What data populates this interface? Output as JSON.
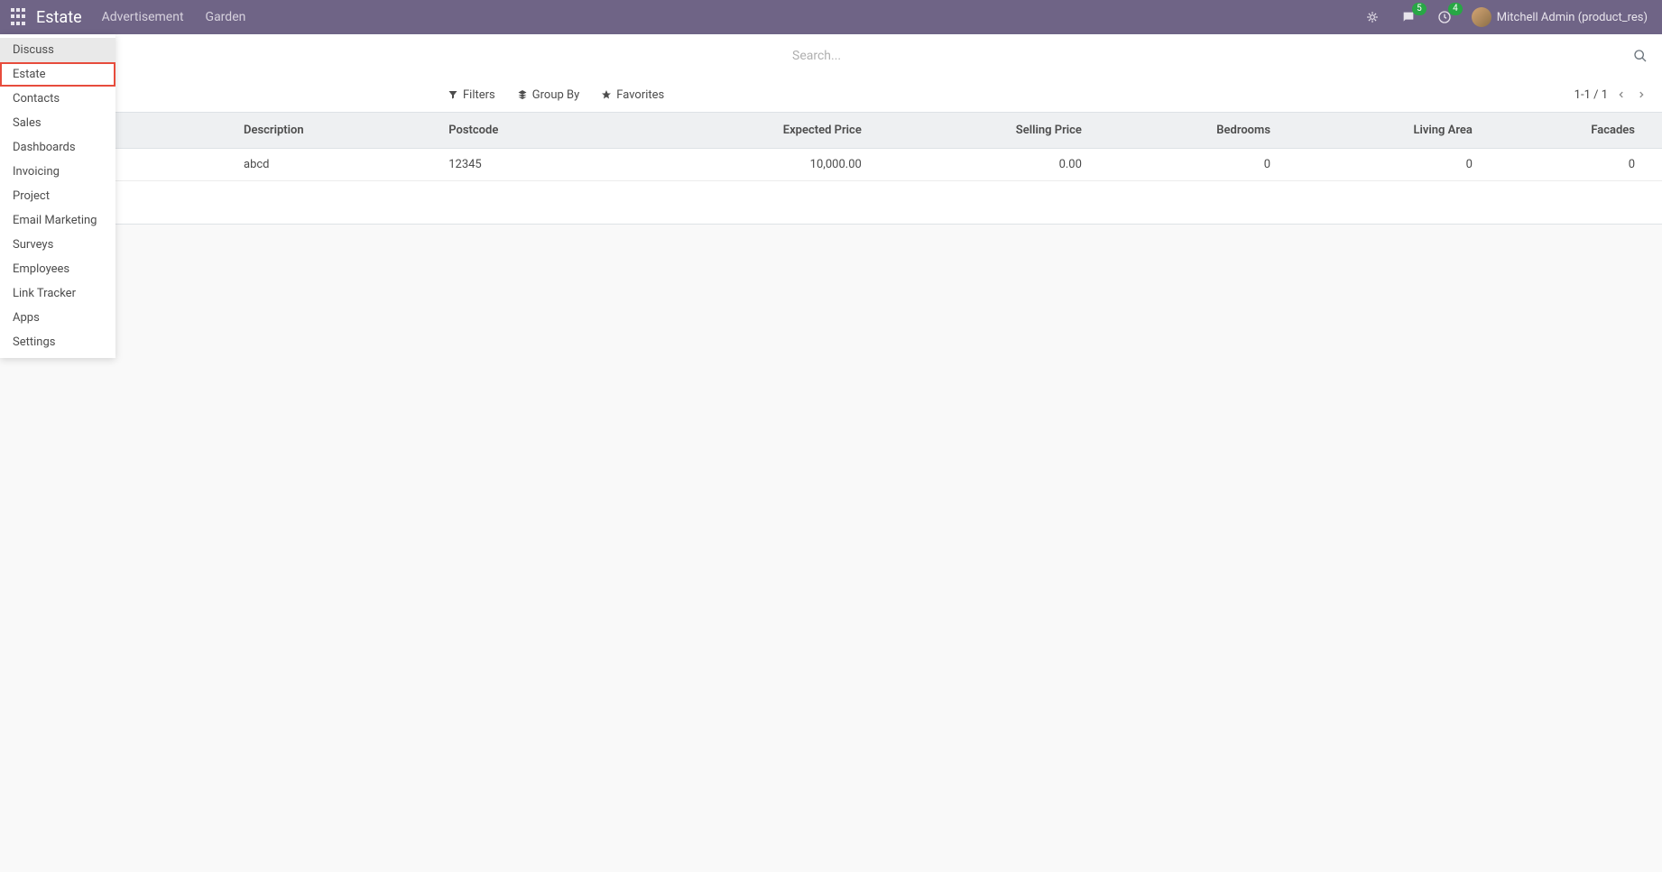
{
  "navbar": {
    "brand": "Estate",
    "links": [
      "Advertisement",
      "Garden"
    ],
    "messaging_badge": "5",
    "activity_badge": "4",
    "user_name": "Mitchell Admin (product_res)"
  },
  "app_menu": {
    "items": [
      "Discuss",
      "Estate",
      "Contacts",
      "Sales",
      "Dashboards",
      "Invoicing",
      "Project",
      "Email Marketing",
      "Surveys",
      "Employees",
      "Link Tracker",
      "Apps",
      "Settings"
    ],
    "hover_index": 0,
    "highlighted_index": 1
  },
  "control_panel": {
    "search_placeholder": "Search...",
    "filters_label": "Filters",
    "groupby_label": "Group By",
    "favorites_label": "Favorites",
    "pager": "1-1 / 1"
  },
  "table": {
    "columns": [
      {
        "key": "description",
        "label": "Description",
        "align": "left"
      },
      {
        "key": "postcode",
        "label": "Postcode",
        "align": "left"
      },
      {
        "key": "expected_price",
        "label": "Expected Price",
        "align": "right"
      },
      {
        "key": "selling_price",
        "label": "Selling Price",
        "align": "right"
      },
      {
        "key": "bedrooms",
        "label": "Bedrooms",
        "align": "right"
      },
      {
        "key": "living_area",
        "label": "Living Area",
        "align": "right"
      },
      {
        "key": "facades",
        "label": "Facades",
        "align": "right"
      }
    ],
    "rows": [
      {
        "description": "abcd",
        "postcode": "12345",
        "expected_price": "10,000.00",
        "selling_price": "0.00",
        "bedrooms": "0",
        "living_area": "0",
        "facades": "0"
      }
    ]
  }
}
